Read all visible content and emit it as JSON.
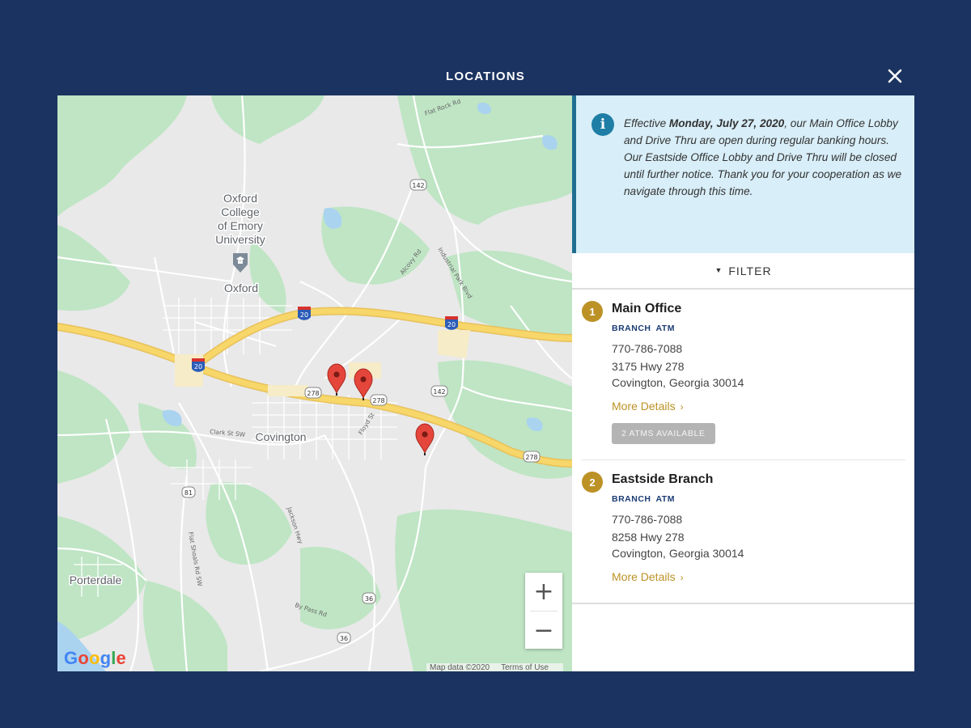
{
  "modal": {
    "title": "LOCATIONS",
    "close_label": "Close"
  },
  "map": {
    "labels": {
      "oxford_college_line1": "Oxford",
      "oxford_college_line2": "College",
      "oxford_college_line3": "of Emory",
      "oxford_college_line4": "University",
      "oxford": "Oxford",
      "covington": "Covington",
      "porterdale": "Porterdale"
    },
    "shields": {
      "i20_a": "20",
      "i20_b": "20",
      "i20_c": "20",
      "r142_a": "142",
      "r142_b": "142",
      "r278_a": "278",
      "r278_b": "278",
      "r278_c": "278",
      "r81": "81",
      "r36_a": "36",
      "r36_b": "36"
    },
    "street_labels": {
      "alcovy": "Alcovy Rd",
      "industrial": "Industrial Park Blvd",
      "flat_rock": "Flat Rock Rd",
      "floyd": "Floyd St",
      "clark": "Clark St SW",
      "jackson": "Jackson Hwy",
      "flat_shoals": "Flat Shoals Rd SW",
      "by_pass": "By Pass Rd"
    },
    "zoom_in": "+",
    "zoom_out": "−",
    "logo": {
      "G": "G",
      "o1": "o",
      "o2": "o",
      "g": "g",
      "l": "l",
      "e": "e"
    },
    "footer": {
      "map_data": "Map data ©2020",
      "terms": "Terms of Use"
    },
    "marker_count": 3
  },
  "notice": {
    "icon": "info-icon",
    "prefix": "Effective ",
    "date": "Monday, July 27, 2020",
    "body": ", our Main Office Lobby and Drive Thru are open during regular banking hours. Our Eastside Office Lobby and Drive Thru will be closed until further notice.  Thank you for your cooperation as we navigate through this time."
  },
  "filter": {
    "label": "FILTER",
    "icon": "chevron-down-icon"
  },
  "locations": [
    {
      "number": "1",
      "name": "Main Office",
      "tags": [
        "BRANCH",
        "ATM"
      ],
      "phone": "770-786-7088",
      "address1": "3175 Hwy 278",
      "address2": "Covington, Georgia 30014",
      "more": "More Details",
      "atms": "2 ATMS AVAILABLE"
    },
    {
      "number": "2",
      "name": "Eastside Branch",
      "tags": [
        "BRANCH",
        "ATM"
      ],
      "phone": "770-786-7088",
      "address1": "8258 Hwy 278",
      "address2": "Covington, Georgia 30014",
      "more": "More Details"
    }
  ],
  "colors": {
    "background": "#1b3360",
    "accent_gold": "#bc9226",
    "notice_bg": "#d8eef8",
    "notice_bar": "#1f6f92",
    "marker": "#e5463b",
    "highway": "#f7d66a"
  }
}
